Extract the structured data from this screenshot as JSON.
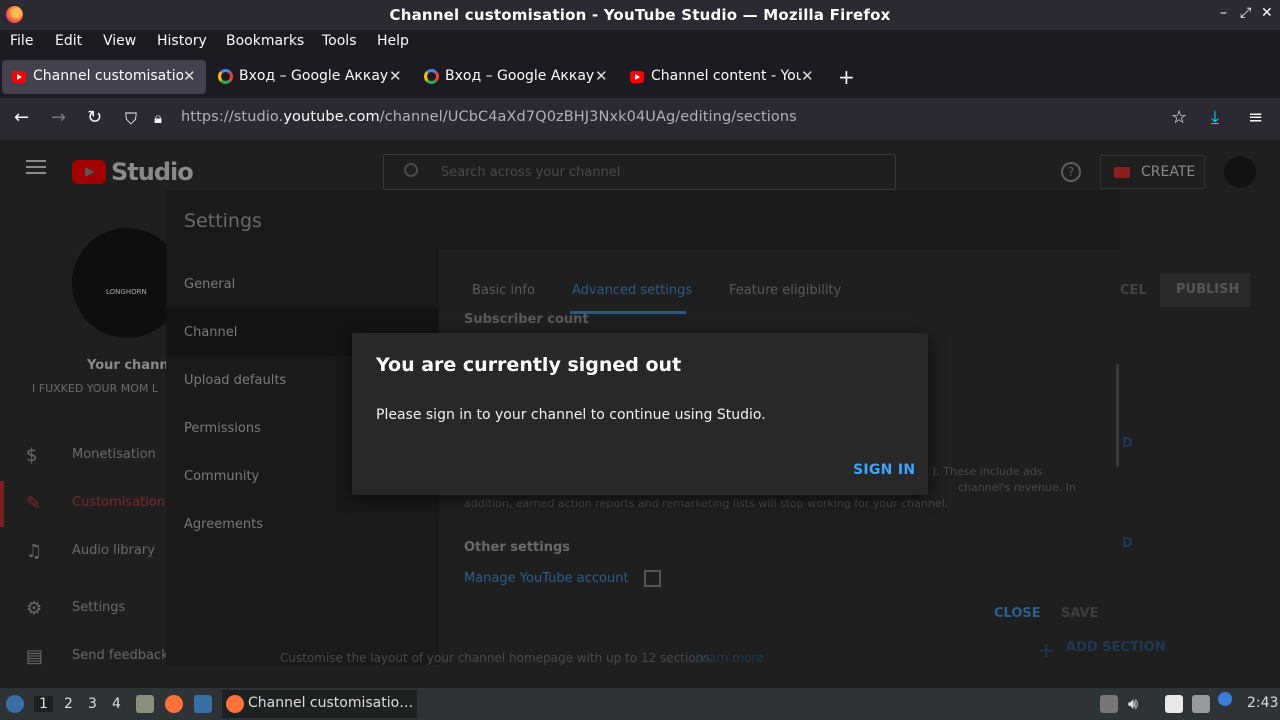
{
  "window": {
    "title": "Channel customisation - YouTube Studio — Mozilla Firefox",
    "controls": [
      "–",
      "⤢",
      "✕"
    ]
  },
  "menubar": {
    "items": [
      "File",
      "Edit",
      "View",
      "History",
      "Bookmarks",
      "Tools",
      "Help"
    ]
  },
  "tabs": [
    {
      "label": "Channel customisatio",
      "icon": "youtube-icon",
      "active": true
    },
    {
      "label": "Вход – Google Аккаун",
      "icon": "google-icon",
      "active": false
    },
    {
      "label": "Вход – Google Аккаун",
      "icon": "google-icon",
      "active": false
    },
    {
      "label": "Channel content - You",
      "icon": "youtube-icon",
      "active": false
    }
  ],
  "newtab": "+",
  "address": {
    "prefix": "https://studio.",
    "domain": "youtube.com",
    "path": "/channel/UCbC4aXd7Q0zBHJ3Nxk04UAg/editing/sections"
  },
  "studio": {
    "logo_text": "Studio",
    "search_placeholder": "Search across your channel",
    "create_label": "CREATE",
    "help_glyph": "?"
  },
  "sidebar": {
    "channel_name": "Your channe",
    "channel_handle": "I FUXKED YOUR MOM L",
    "avatar_text": "LONGHORN",
    "items": [
      {
        "label": "Monetisation",
        "icon": "dollar-icon"
      },
      {
        "label": "Customisation",
        "icon": "wand-icon"
      },
      {
        "label": "Audio library",
        "icon": "music-library-icon"
      },
      {
        "label": "Settings",
        "icon": "gear-icon"
      },
      {
        "label": "Send feedback",
        "icon": "feedback-icon"
      }
    ]
  },
  "settings": {
    "title": "Settings",
    "nav": [
      "General",
      "Channel",
      "Upload defaults",
      "Permissions",
      "Community",
      "Agreements"
    ],
    "tabs": [
      "Basic info",
      "Advanced settings",
      "Feature eligibility"
    ],
    "subscriber_heading": "Subscriber count",
    "partial_text_1": "). These include ads",
    "partial_text_2": "channel's revenue. In",
    "partial_text_3": "addition, earned action reports and remarketing lists will stop working for your channel.",
    "other_settings": "Other settings",
    "manage_link": "Manage YouTube account",
    "close": "CLOSE",
    "save": "SAVE",
    "cancel_partial": "CEL",
    "publish": "PUBLISH",
    "side_d1": "D",
    "side_d2": "D"
  },
  "footer": {
    "text": "Customise the layout of your channel homepage with up to 12 sections.",
    "learn_more": "Learn more",
    "add_section": "ADD SECTION"
  },
  "dialog": {
    "title": "You are currently signed out",
    "message": "Please sign in to your channel to continue using Studio.",
    "button": "SIGN IN"
  },
  "taskbar": {
    "workspaces": [
      "1",
      "2",
      "3",
      "4"
    ],
    "window_label": "Channel customisatio…",
    "clock": "2:43"
  }
}
